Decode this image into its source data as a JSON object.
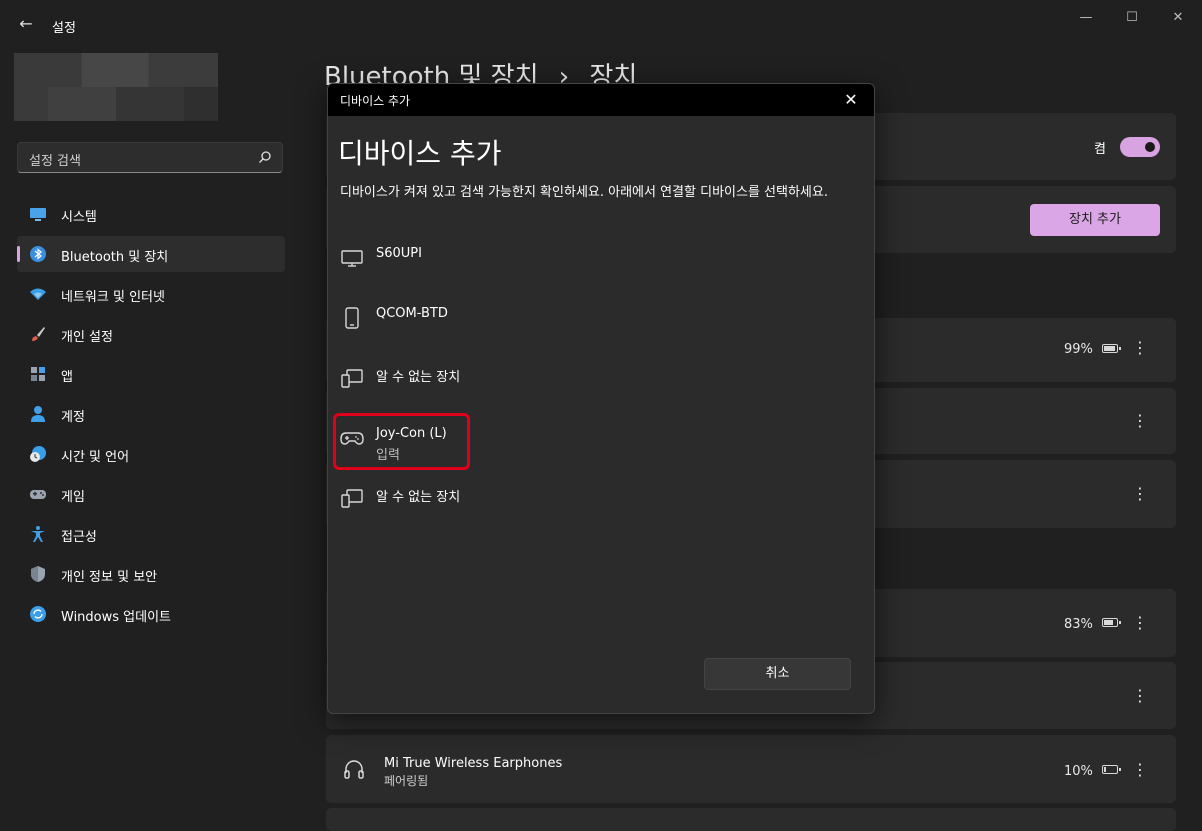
{
  "app": {
    "title": "설정"
  },
  "window_controls": [
    "minimize",
    "maximize",
    "close"
  ],
  "sidebar": {
    "search_placeholder": "설정 검색",
    "items": [
      {
        "label": "시스템",
        "icon": "monitor-icon",
        "active": false
      },
      {
        "label": "Bluetooth 및 장치",
        "icon": "bluetooth-icon",
        "active": true
      },
      {
        "label": "네트워크 및 인터넷",
        "icon": "wifi-icon",
        "active": false
      },
      {
        "label": "개인 설정",
        "icon": "brush-icon",
        "active": false
      },
      {
        "label": "앱",
        "icon": "apps-icon",
        "active": false
      },
      {
        "label": "계정",
        "icon": "person-icon",
        "active": false
      },
      {
        "label": "시간 및 언어",
        "icon": "globe-clock-icon",
        "active": false
      },
      {
        "label": "게임",
        "icon": "gamepad-icon",
        "active": false
      },
      {
        "label": "접근성",
        "icon": "accessibility-icon",
        "active": false
      },
      {
        "label": "개인 정보 및 보안",
        "icon": "shield-icon",
        "active": false
      },
      {
        "label": "Windows 업데이트",
        "icon": "update-icon",
        "active": false
      }
    ]
  },
  "main": {
    "breadcrumb_parent": "Bluetooth 및 장치",
    "breadcrumb_sep": "›",
    "breadcrumb_current": "장치",
    "toggle_label": "켬",
    "add_device_button": "장치 추가",
    "battery_rows": [
      {
        "percent": "99%",
        "level": 0.99
      },
      {
        "percent": "83%",
        "level": 0.83
      },
      {
        "percent": "10%",
        "level": 0.1
      }
    ],
    "visible_device": {
      "name": "Mi True Wireless Earphones",
      "status": "페어링됨",
      "icon": "headphones-icon"
    }
  },
  "dialog": {
    "title": "디바이스 추가",
    "heading": "디바이스 추가",
    "description": "디바이스가 켜져 있고 검색 가능한지 확인하세요. 아래에서 연결할 디바이스를 선택하세요.",
    "devices": [
      {
        "name": "S60UPI",
        "sub": "",
        "icon": "monitor-icon"
      },
      {
        "name": "QCOM-BTD",
        "sub": "",
        "icon": "phone-icon"
      },
      {
        "name": "알 수 없는 장치",
        "sub": "",
        "icon": "devices-icon"
      },
      {
        "name": "Joy-Con (L)",
        "sub": "입력",
        "icon": "gamepad-icon"
      },
      {
        "name": "알 수 없는 장치",
        "sub": "",
        "icon": "devices-icon"
      }
    ],
    "cancel_button": "취소"
  },
  "colors": {
    "accent": "#d7a3e0",
    "highlight": "#e0001a",
    "background": "#202020",
    "card": "#2b2b2b"
  }
}
